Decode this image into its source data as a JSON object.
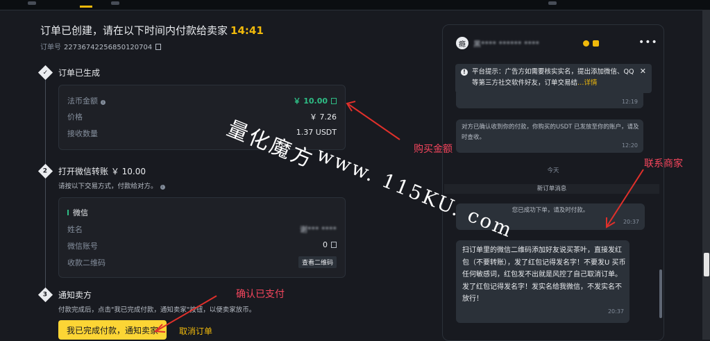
{
  "header": {
    "title": "订单已创建，请在以下时间内付款给卖家",
    "timer": "14:41",
    "order_label": "订单号",
    "order_no": "22736742256850120704"
  },
  "steps": [
    {
      "num": "",
      "title": "订单已生成"
    },
    {
      "num": "2",
      "title": "打开微信转账 ￥ 10.00",
      "desc": "请按以下交易方式，付款给对方。"
    },
    {
      "num": "3",
      "title": "通知卖方",
      "desc": "付款完成后，点击\"我已完成付款，通知卖家\"按钮，以便卖家放币。"
    }
  ],
  "order_card": {
    "fiat_label": "法币金额",
    "fiat_value": "￥ 10.00",
    "price_label": "价格",
    "price_value": "￥ 7.26",
    "qty_label": "接收数量",
    "qty_value": "1.37 USDT"
  },
  "payment_card": {
    "method": "微信",
    "name_label": "姓名",
    "name_value": "谢*** ****",
    "account_label": "微信账号",
    "account_value": "0",
    "qr_label": "收款二维码",
    "qr_button": "查看二维码"
  },
  "actions": {
    "paid": "我已完成付款，通知卖家",
    "cancel": "取消订单"
  },
  "chat": {
    "seller_name": "黑**** ****** ****",
    "notice_text": "平台提示：广告方如需要核实实名，提出添加微信、QQ等第三方社交软件好友，订单交易结",
    "notice_link": "…详情",
    "msg1_time": "12:19",
    "msg2": "对方已确认收到你的付款，你购买的USDT 已发放至你的账户，请及时查收。",
    "msg2_time": "12:20",
    "date_divider": "今天",
    "sys_message": "新订单消息",
    "msg3": "您已成功下单，请及时付款。",
    "msg3_time": "20:37",
    "msg4": "扫订单里的微信二维码添加好友说买茶叶，直接发红包（不要转账），发了红包记得发名字！不要发U 买币任何敏感词，红包发不出就是风控了自己取消订单。发了红包记得发名字！发实名给我微信，不发实名不放行！",
    "msg4_time": "20:37"
  },
  "annotations": {
    "buy_amount": "购买金额",
    "contact_seller": "联系商家",
    "confirm_paid": "确认已支付",
    "watermark_1": "量化魔方",
    "watermark_2": "www. 115KU. com"
  },
  "colors": {
    "background": "#181a20",
    "accent_yellow": "#fcd535",
    "green": "#2ebd85",
    "annotation_red": "#f6465d"
  }
}
